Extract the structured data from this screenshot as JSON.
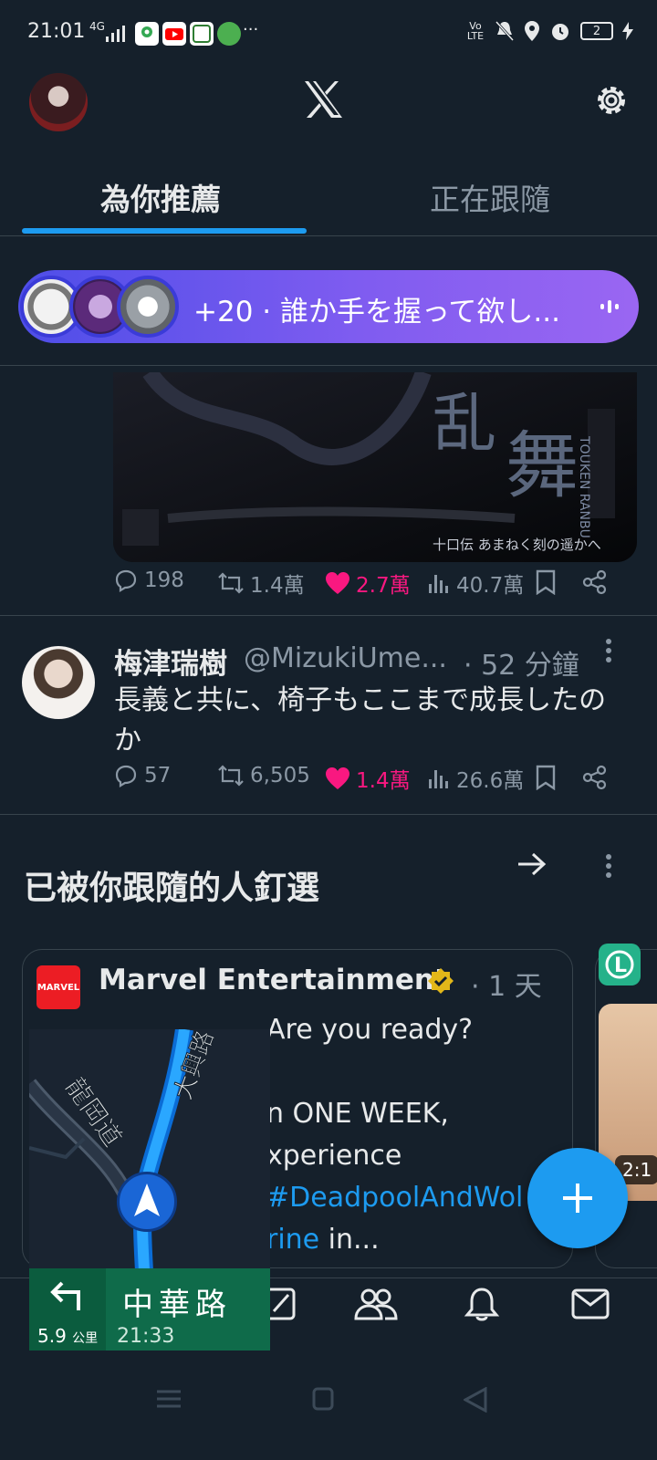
{
  "status_bar": {
    "time": "21:01",
    "network": "4G",
    "battery": "2",
    "more": "···",
    "volte": "Vo LTE"
  },
  "header": {
    "logo": "x-logo-icon",
    "settings": "gear-icon"
  },
  "tabs": [
    {
      "label": "為你推薦",
      "active": true
    },
    {
      "label": "正在跟隨",
      "active": false
    }
  ],
  "spaces_pill": {
    "text": "+20 · 誰か手を握って欲し..."
  },
  "prev_tweet_actions": {
    "replies": "198",
    "reposts": "1.4萬",
    "likes": "2.7萬",
    "views": "40.7萬"
  },
  "media_caption": "十口伝 あまねく刻の遥かへ",
  "tweet": {
    "name": "梅津瑞樹",
    "handle": "@MizukiUme...",
    "time": "· 52 分鐘",
    "text": "長義と共に、椅子もここまで成長したのか",
    "replies": "57",
    "reposts": "6,505",
    "likes": "1.4萬",
    "views": "26.6萬"
  },
  "pinned": {
    "title": "已被你跟隨的人釘選",
    "card": {
      "logo_text": "MARVEL",
      "name": "Marvel Entertainment",
      "time": "· 1 天",
      "text_lines": [
        "Are you ready?",
        "",
        "n ONE WEEK,",
        "xperience"
      ],
      "hashtag": "#DeadpoolAndWol",
      "hashtag2": "rine",
      "tail": " in..."
    },
    "side_time": "2:1"
  },
  "navigation_widget": {
    "road_name": "中華路",
    "eta": "21:33",
    "distance": "5.9",
    "distance_unit": "公里",
    "map_labels": [
      "龍岡道",
      "大興路"
    ]
  },
  "colors": {
    "accent": "#1d9bf0",
    "like": "#f91880",
    "background": "#15202b",
    "nav_green": "#0f6b4a"
  }
}
